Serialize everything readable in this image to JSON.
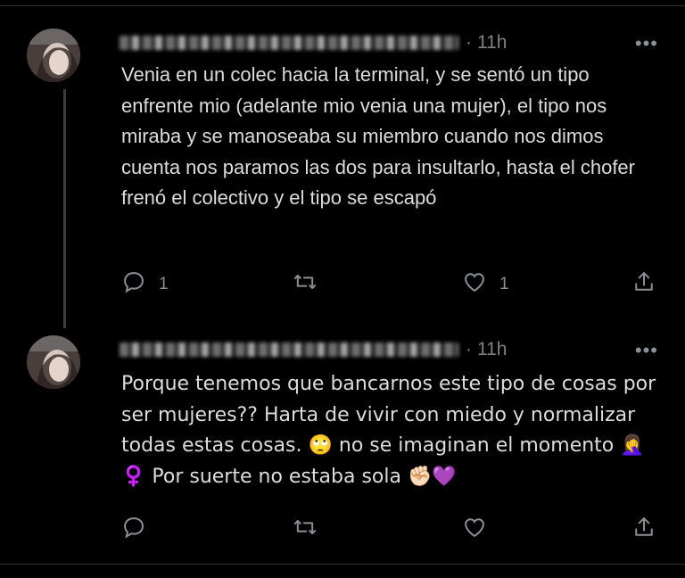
{
  "tweets": [
    {
      "time": "11h",
      "more_label": "•••",
      "text": "Venia en un colec hacia la terminal, y se sentó un tipo enfrente mio (adelante mio venia una mujer), el tipo nos miraba y se manoseaba su miembro cuando nos dimos cuenta nos paramos las dos para insultarlo, hasta el chofer frenó el colectivo y el tipo se escapó",
      "reply_count": "1",
      "retweet_count": "",
      "like_count": "1",
      "icons": [
        "reply-icon",
        "retweet-icon",
        "like-icon",
        "share-icon"
      ]
    },
    {
      "time": "11h",
      "more_label": "•••",
      "text": "Porque tenemos que bancarnos este tipo de cosas por ser mujeres?? Harta de vivir con miedo y normalizar todas estas cosas. 🙄 no se imaginan el momento 🤦‍♀️ ♀️ Por suerte no estaba sola ✊🏻💜",
      "reply_count": "",
      "retweet_count": "",
      "like_count": "",
      "icons": [
        "reply-icon",
        "retweet-icon",
        "like-icon",
        "share-icon"
      ]
    }
  ],
  "colors": {
    "background": "#000000",
    "text": "#dcdcdc",
    "muted": "#8b9096",
    "divider": "#2f3336"
  }
}
